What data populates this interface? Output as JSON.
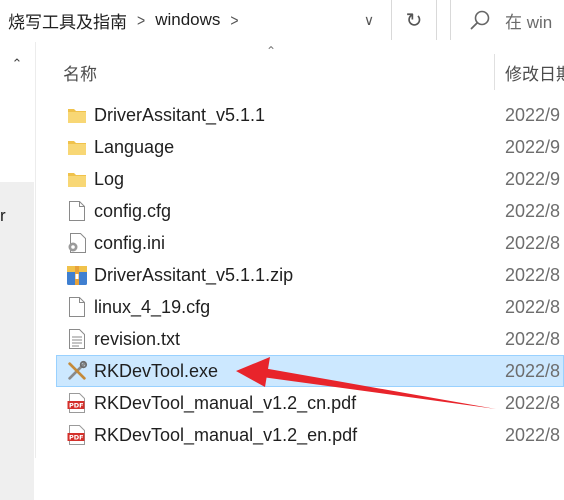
{
  "address_bar": {
    "path": [
      "烧写工具及指南",
      "windows"
    ],
    "separator": ">",
    "dropdown_glyph": "∨",
    "refresh_glyph": "↻",
    "search_placeholder": "在 win"
  },
  "nav": {
    "scroll_up_glyph": "⌃",
    "partial_letter": "r"
  },
  "file_list": {
    "columns": {
      "name": "名称",
      "date": "修改日期"
    },
    "sort_glyph": "⌃",
    "rows": [
      {
        "name": "DriverAssitant_v5.1.1",
        "icon": "folder-icon",
        "date": "2022/9"
      },
      {
        "name": "Language",
        "icon": "folder-icon",
        "date": "2022/9"
      },
      {
        "name": "Log",
        "icon": "folder-icon",
        "date": "2022/9"
      },
      {
        "name": "config.cfg",
        "icon": "blank-file-icon",
        "date": "2022/8"
      },
      {
        "name": "config.ini",
        "icon": "ini-file-icon",
        "date": "2022/8"
      },
      {
        "name": "DriverAssitant_v5.1.1.zip",
        "icon": "zip-file-icon",
        "date": "2022/8"
      },
      {
        "name": "linux_4_19.cfg",
        "icon": "blank-file-icon",
        "date": "2022/8"
      },
      {
        "name": "revision.txt",
        "icon": "text-file-icon",
        "date": "2022/8"
      },
      {
        "name": "RKDevTool.exe",
        "icon": "tools-exe-icon",
        "date": "2022/8",
        "selected": true
      },
      {
        "name": "RKDevTool_manual_v1.2_cn.pdf",
        "icon": "pdf-file-icon",
        "date": "2022/8"
      },
      {
        "name": "RKDevTool_manual_v1.2_en.pdf",
        "icon": "pdf-file-icon",
        "date": "2022/8"
      }
    ]
  },
  "colors": {
    "selection_bg": "#cce8ff",
    "selection_border": "#99d1ff",
    "folder": "#f0c24b",
    "annotation_arrow": "#e8242b",
    "pdf": "#d4302b"
  }
}
